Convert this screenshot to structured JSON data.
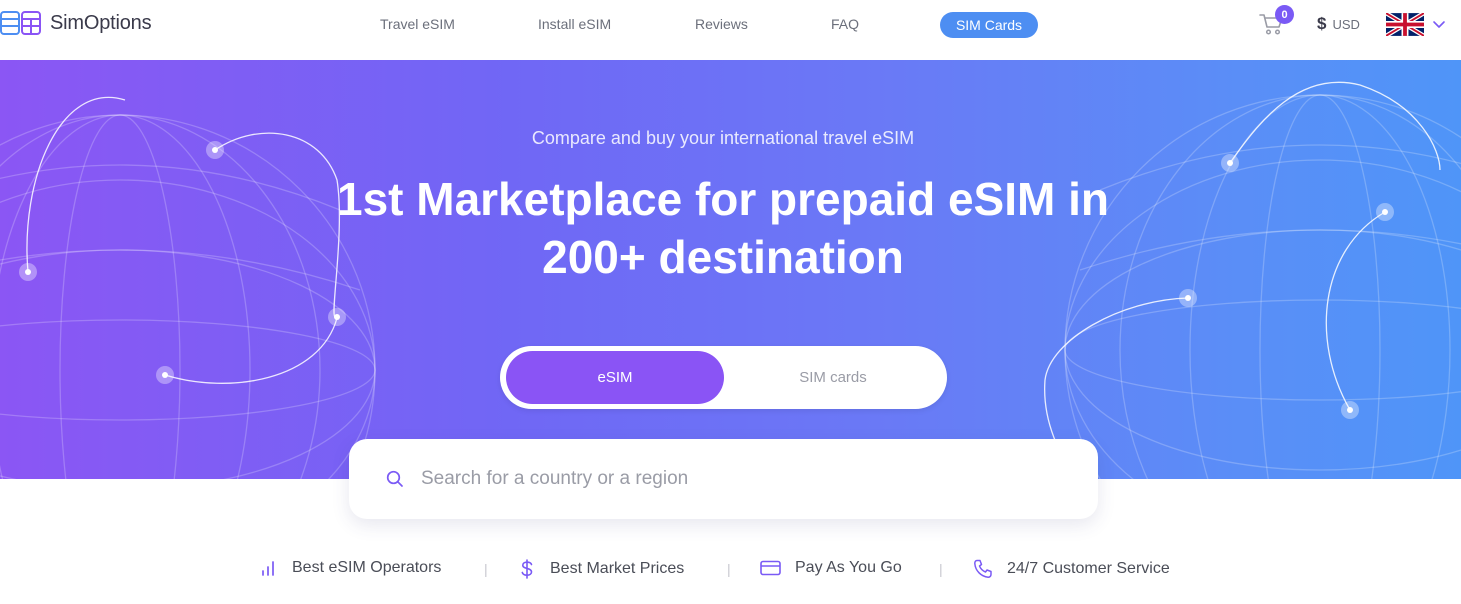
{
  "brand": {
    "name": "SimOptions"
  },
  "nav": {
    "items": [
      {
        "label": "Travel eSIM"
      },
      {
        "label": "Install eSIM"
      },
      {
        "label": "Reviews"
      },
      {
        "label": "FAQ"
      }
    ],
    "highlight": {
      "label": "SIM Cards"
    }
  },
  "cart": {
    "count": "0",
    "icon": "cart-icon"
  },
  "currency": {
    "symbol": "$",
    "code": "USD"
  },
  "language": {
    "flag": "uk-flag-icon"
  },
  "hero": {
    "subtitle": "Compare and buy your international travel eSIM",
    "title_line1": "1st Marketplace for prepaid eSIM in",
    "title_line2": "200+ destination"
  },
  "toggle": {
    "active_label": "eSIM",
    "inactive_label": "SIM cards"
  },
  "search": {
    "placeholder": "Search for a country or a region"
  },
  "features": [
    {
      "icon": "signal-bars-icon",
      "label": "Best eSIM Operators"
    },
    {
      "icon": "dollar-icon",
      "label": "Best Market Prices"
    },
    {
      "icon": "credit-card-icon",
      "label": "Pay As You Go"
    },
    {
      "icon": "phone-icon",
      "label": "24/7 Customer Service"
    }
  ],
  "colors": {
    "accent_purple": "#8a54f5",
    "accent_blue": "#4d8ef2",
    "badge": "#7a5af5",
    "feature_icon": "#7a5af5"
  }
}
